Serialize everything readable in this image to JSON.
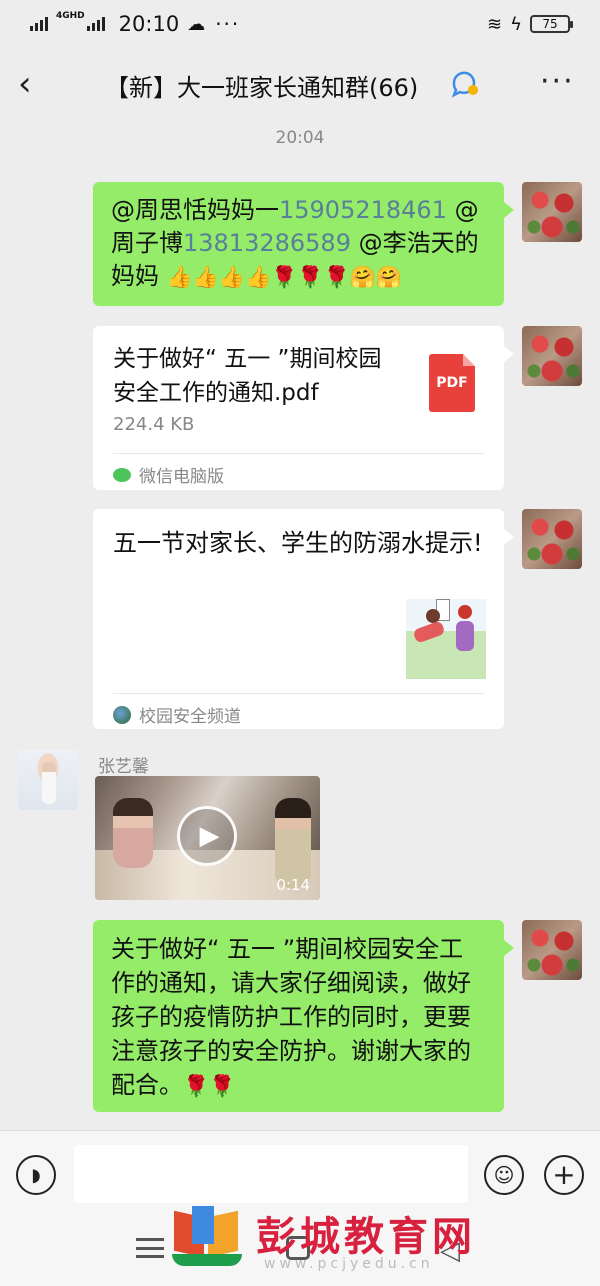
{
  "status": {
    "signal_label": "G",
    "network": "4GHD",
    "time": "20:10",
    "battery": "75"
  },
  "header": {
    "back_icon": "back-arrow-icon",
    "title": "【新】大一班家长通知群(66)",
    "more_icon": "more-icon"
  },
  "timestamp": "20:04",
  "messages": {
    "m1": {
      "p1": "@周思恬妈妈一",
      "phone1": "15905218461",
      "p2": " @周子博",
      "phone2": "13813286589",
      "p3": " @李浩天的妈妈 ",
      "emoji": "👍👍👍👍🌹🌹🌹🤗🤗"
    },
    "file": {
      "name": "关于做好“ 五一 ”期间校园安全工作的通知.pdf",
      "size": "224.4 KB",
      "icon_label": "PDF",
      "source": "微信电脑版"
    },
    "article": {
      "title": "五一节对家长、学生的防溺水提示!",
      "source": "校园安全频道"
    },
    "video": {
      "sender": "张艺馨",
      "duration": "0:14"
    },
    "m2": {
      "text": "关于做好“ 五一 ”期间校园安全工作的通知，请大家仔细阅读，做好孩子的疫情防护工作的同时，更要注意孩子的安全防护。谢谢大家的配合。",
      "emoji": "🌹🌹"
    }
  },
  "input": {
    "value": "",
    "placeholder": ""
  },
  "watermark": {
    "text": "彭城教育网",
    "url": "www.pcjyedu.cn"
  },
  "colors": {
    "bubble_green": "#95ec69",
    "background": "#ededed",
    "phone_link": "#5a7f9a",
    "pdf_red": "#e8413c"
  }
}
